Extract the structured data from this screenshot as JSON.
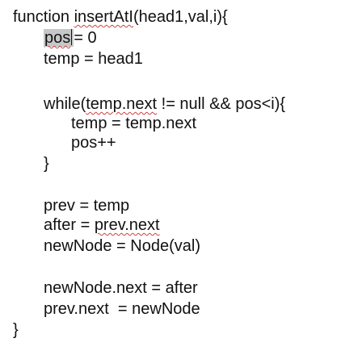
{
  "code": {
    "line1": {
      "kw": "function ",
      "fn": "insertAtI",
      "args": "(head1,val,i){"
    },
    "line2": {
      "var": "pos",
      "rest": "= 0"
    },
    "line3": "temp = head1",
    "line4": {
      "pre": "while(",
      "sq": "temp.next",
      "post": " != null && pos<i){"
    },
    "line5": "temp = temp.next",
    "line6": "pos++",
    "line7": "}",
    "line8": "prev = temp",
    "line9": {
      "pre": "after = ",
      "sq": "prev.next"
    },
    "line10": "newNode = Node(val)",
    "line11": "newNode.next = after",
    "line12": "prev.next  = newNode",
    "line13": "}"
  },
  "colors": {
    "text": "#111111",
    "selection": "#c7c7c7",
    "spellcheck": "#d04040",
    "background": "#ffffff"
  }
}
